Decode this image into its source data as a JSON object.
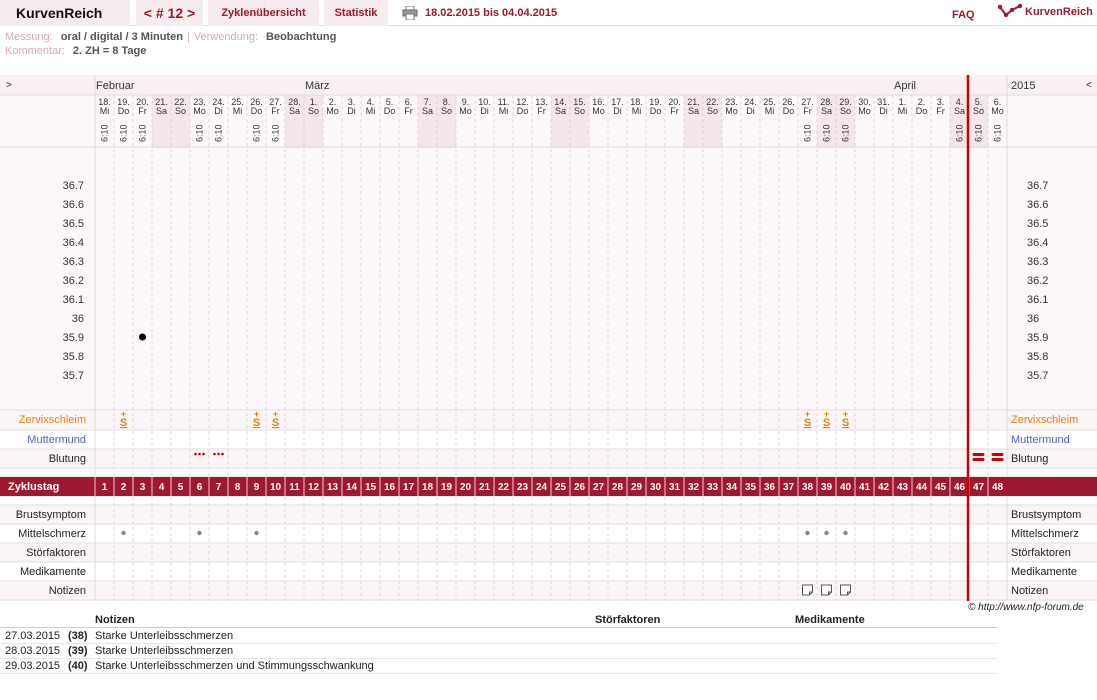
{
  "app": {
    "brand": "KurvenReich",
    "logo_text": "KurvenReich"
  },
  "nav": {
    "cycle": "< # 12 >",
    "overview": "Zyklenübersicht",
    "stats": "Statistik",
    "faq": "FAQ"
  },
  "date_range": "18.02.2015 bis 04.04.2015",
  "meta": {
    "measure_label": "Messung:",
    "measure_value": "oral / digital / 3 Minuten",
    "use_label": "Verwendung:",
    "use_value": "Beobachtung",
    "comment_label": "Kommentar:",
    "comment_value": "2. ZH = 8 Tage"
  },
  "header": {
    "left_arrow": ">",
    "year": "2015",
    "right_arrow": "<",
    "months": [
      {
        "label": "Februar",
        "day_index": 0
      },
      {
        "label": "März",
        "day_index": 11
      },
      {
        "label": "April",
        "day_index": 42
      }
    ]
  },
  "days": [
    {
      "d": "18.",
      "w": "Mi",
      "t": "6:10",
      "we": false
    },
    {
      "d": "19.",
      "w": "Do",
      "t": "6:10",
      "we": false
    },
    {
      "d": "20.",
      "w": "Fr",
      "t": "6:10",
      "we": false
    },
    {
      "d": "21.",
      "w": "Sa",
      "t": "",
      "we": true
    },
    {
      "d": "22.",
      "w": "So",
      "t": "",
      "we": true
    },
    {
      "d": "23.",
      "w": "Mo",
      "t": "6:10",
      "we": false
    },
    {
      "d": "24.",
      "w": "Di",
      "t": "6:10",
      "we": false
    },
    {
      "d": "25.",
      "w": "Mi",
      "t": "",
      "we": false
    },
    {
      "d": "26.",
      "w": "Do",
      "t": "6:10",
      "we": false
    },
    {
      "d": "27.",
      "w": "Fr",
      "t": "6:10",
      "we": false
    },
    {
      "d": "28.",
      "w": "Sa",
      "t": "",
      "we": true
    },
    {
      "d": "1.",
      "w": "So",
      "t": "",
      "we": true
    },
    {
      "d": "2.",
      "w": "Mo",
      "t": "",
      "we": false
    },
    {
      "d": "3.",
      "w": "Di",
      "t": "",
      "we": false
    },
    {
      "d": "4.",
      "w": "Mi",
      "t": "",
      "we": false
    },
    {
      "d": "5.",
      "w": "Do",
      "t": "",
      "we": false
    },
    {
      "d": "6.",
      "w": "Fr",
      "t": "",
      "we": false
    },
    {
      "d": "7.",
      "w": "Sa",
      "t": "",
      "we": true
    },
    {
      "d": "8.",
      "w": "So",
      "t": "",
      "we": true
    },
    {
      "d": "9.",
      "w": "Mo",
      "t": "",
      "we": false
    },
    {
      "d": "10.",
      "w": "Di",
      "t": "",
      "we": false
    },
    {
      "d": "11.",
      "w": "Mi",
      "t": "",
      "we": false
    },
    {
      "d": "12.",
      "w": "Do",
      "t": "",
      "we": false
    },
    {
      "d": "13.",
      "w": "Fr",
      "t": "",
      "we": false
    },
    {
      "d": "14.",
      "w": "Sa",
      "t": "",
      "we": true
    },
    {
      "d": "15.",
      "w": "So",
      "t": "",
      "we": true
    },
    {
      "d": "16.",
      "w": "Mo",
      "t": "",
      "we": false
    },
    {
      "d": "17.",
      "w": "Di",
      "t": "",
      "we": false
    },
    {
      "d": "18.",
      "w": "Mi",
      "t": "",
      "we": false
    },
    {
      "d": "19.",
      "w": "Do",
      "t": "",
      "we": false
    },
    {
      "d": "20.",
      "w": "Fr",
      "t": "",
      "we": false
    },
    {
      "d": "21.",
      "w": "Sa",
      "t": "",
      "we": true
    },
    {
      "d": "22.",
      "w": "So",
      "t": "",
      "we": true
    },
    {
      "d": "23.",
      "w": "Mo",
      "t": "",
      "we": false
    },
    {
      "d": "24.",
      "w": "Di",
      "t": "",
      "we": false
    },
    {
      "d": "25.",
      "w": "Mi",
      "t": "",
      "we": false
    },
    {
      "d": "26.",
      "w": "Do",
      "t": "",
      "we": false
    },
    {
      "d": "27.",
      "w": "Fr",
      "t": "6:10",
      "we": false
    },
    {
      "d": "28.",
      "w": "Sa",
      "t": "6:10",
      "we": true
    },
    {
      "d": "29.",
      "w": "So",
      "t": "6:10",
      "we": true
    },
    {
      "d": "30.",
      "w": "Mo",
      "t": "",
      "we": false
    },
    {
      "d": "31.",
      "w": "Di",
      "t": "",
      "we": false
    },
    {
      "d": "1.",
      "w": "Mi",
      "t": "",
      "we": false
    },
    {
      "d": "2.",
      "w": "Do",
      "t": "",
      "we": false
    },
    {
      "d": "3.",
      "w": "Fr",
      "t": "",
      "we": false
    },
    {
      "d": "4.",
      "w": "Sa",
      "t": "6:10",
      "we": true
    },
    {
      "d": "5.",
      "w": "So",
      "t": "6:10",
      "we": true
    },
    {
      "d": "6.",
      "w": "Mo",
      "t": "6:10",
      "we": false
    }
  ],
  "temp_ticks": [
    "36.7",
    "36.6",
    "36.5",
    "36.4",
    "36.3",
    "36.2",
    "36.1",
    "36",
    "35.9",
    "35.8",
    "35.7"
  ],
  "temperatures": [
    {
      "day_index": 2,
      "value": 35.9
    }
  ],
  "rows": {
    "cervix": "Zervixschleim",
    "cervix_color": "#e8820c",
    "mouth": "Muttermund",
    "mouth_color": "#4a5fc8",
    "bleeding": "Blutung",
    "cycle": "Zyklustag",
    "breast": "Brustsymptom",
    "pain": "Mittelschmerz",
    "disturb": "Störfaktoren",
    "meds": "Medikamente",
    "notes": "Notizen"
  },
  "cervix_days": [
    1,
    8,
    9,
    37,
    38,
    39
  ],
  "cervix_symbol": "S",
  "bleeding_light_days": [
    5,
    6
  ],
  "bleeding_heavy_days": [
    46,
    47
  ],
  "pain_days": [
    1,
    5,
    8,
    37,
    38,
    39
  ],
  "note_days": [
    37,
    38,
    39
  ],
  "cycle_line_after_index": 45,
  "colors": {
    "accent": "#a01830",
    "weekend": "#f4e6ea",
    "rowalt": "#fbf5f6",
    "redline": "#cc0000"
  },
  "bottom": {
    "notes_header": "Notizen",
    "disturb_header": "Störfaktoren",
    "meds_header": "Medikamente",
    "copyright": "© http://www.nfp-forum.de",
    "entries": [
      {
        "date": "27.03.2015",
        "num": "(38)",
        "text": "Starke Unterleibsschmerzen"
      },
      {
        "date": "28.03.2015",
        "num": "(39)",
        "text": "Starke Unterleibsschmerzen"
      },
      {
        "date": "29.03.2015",
        "num": "(40)",
        "text": "Starke Unterleibsschmerzen und Stimmungsschwankung"
      }
    ]
  }
}
